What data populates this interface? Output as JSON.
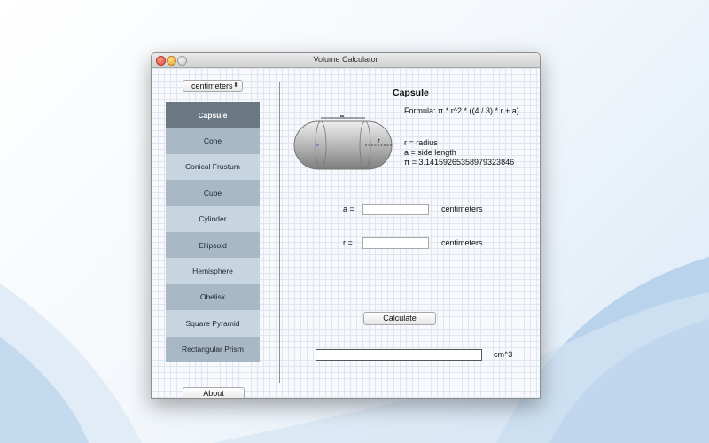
{
  "window": {
    "title": "Volume Calculator"
  },
  "unit_select": {
    "value": "centimeters",
    "arrows": "⬍"
  },
  "shapes": [
    {
      "label": "Capsule",
      "selected": true
    },
    {
      "label": "Cone"
    },
    {
      "label": "Conical Frustum"
    },
    {
      "label": "Cube"
    },
    {
      "label": "Cylinder"
    },
    {
      "label": "Ellipsoid"
    },
    {
      "label": "Hemisphere"
    },
    {
      "label": "Obelisk"
    },
    {
      "label": "Square Pyramid"
    },
    {
      "label": "Rectangular Prism"
    }
  ],
  "about_label": "About",
  "detail": {
    "title": "Capsule",
    "formula": "Formula: π * r^2 * ((4 / 3) * r + a)",
    "legend": [
      "r = radius",
      "a = side length",
      "π = 3.14159265358979323846"
    ],
    "diagram_labels": {
      "a": "a",
      "r": "r"
    }
  },
  "inputs": {
    "a_label": "a =",
    "a_value": "",
    "a_unit": "centimeters",
    "r_label": "r =",
    "r_value": "",
    "r_unit": "centimeters"
  },
  "calculate_label": "Calculate",
  "result": {
    "value": "",
    "unit": "cm^3"
  },
  "colors": {
    "selected_item": "#6a7883",
    "item_dark": "#a8b8c5",
    "item_light": "#c7d5e0"
  }
}
